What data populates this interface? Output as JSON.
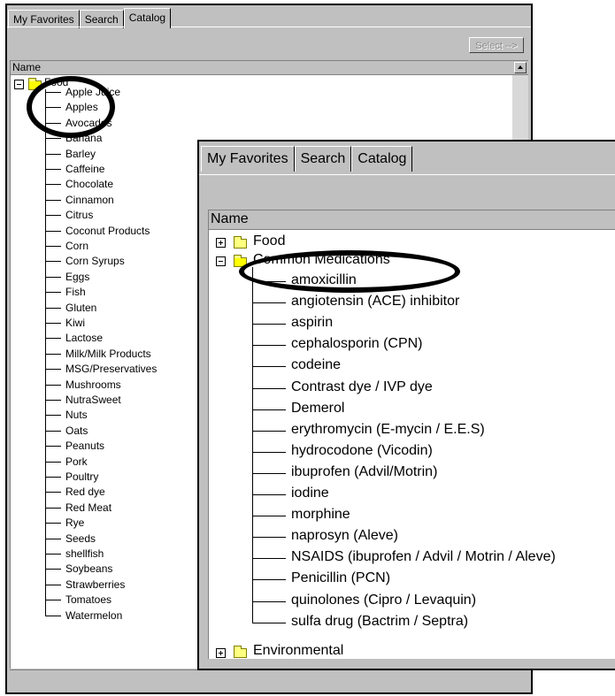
{
  "back_window": {
    "tabs": [
      "My Favorites",
      "Search",
      "Catalog"
    ],
    "active_tab": "Catalog",
    "select_button": "Select -->",
    "column_header": "Name",
    "root_label": "Food",
    "items": [
      "Apple Juice",
      "Apples",
      "Avocados",
      "Banana",
      "Barley",
      "Caffeine",
      "Chocolate",
      "Cinnamon",
      "Citrus",
      "Coconut Products",
      "Corn",
      "Corn Syrups",
      "Eggs",
      "Fish",
      "Gluten",
      "Kiwi",
      "Lactose",
      "Milk/Milk Products",
      "MSG/Preservatives",
      "Mushrooms",
      "NutraSweet",
      "Nuts",
      "Oats",
      "Peanuts",
      "Pork",
      "Poultry",
      "Red dye",
      "Red Meat",
      "Rye",
      "Seeds",
      "shellfish",
      "Soybeans",
      "Strawberries",
      "Tomatoes",
      "Watermelon"
    ]
  },
  "front_window": {
    "tabs": [
      "My Favorites",
      "Search",
      "Catalog"
    ],
    "active_tab": "Catalog",
    "column_header": "Name",
    "folders": {
      "food": "Food",
      "common_medications": "Common Medications",
      "environmental": "Environmental"
    },
    "medications": [
      "amoxicillin",
      "angiotensin (ACE) inhibitor",
      "aspirin",
      "cephalosporin (CPN)",
      "codeine",
      "Contrast dye / IVP dye",
      "Demerol",
      "erythromycin (E-mycin / E.E.S)",
      "hydrocodone (Vicodin)",
      "ibuprofen (Advil/Motrin)",
      "iodine",
      "morphine",
      "naprosyn (Aleve)",
      "NSAIDS (ibuprofen / Advil / Motrin / Aleve)",
      "Penicillin (PCN)",
      "quinolones (Cipro / Levaquin)",
      "sulfa drug (Bactrim / Septra)"
    ]
  },
  "colors": {
    "panel": "#c0c0c0",
    "folder": "#ffff80",
    "annotation": "#000000"
  }
}
